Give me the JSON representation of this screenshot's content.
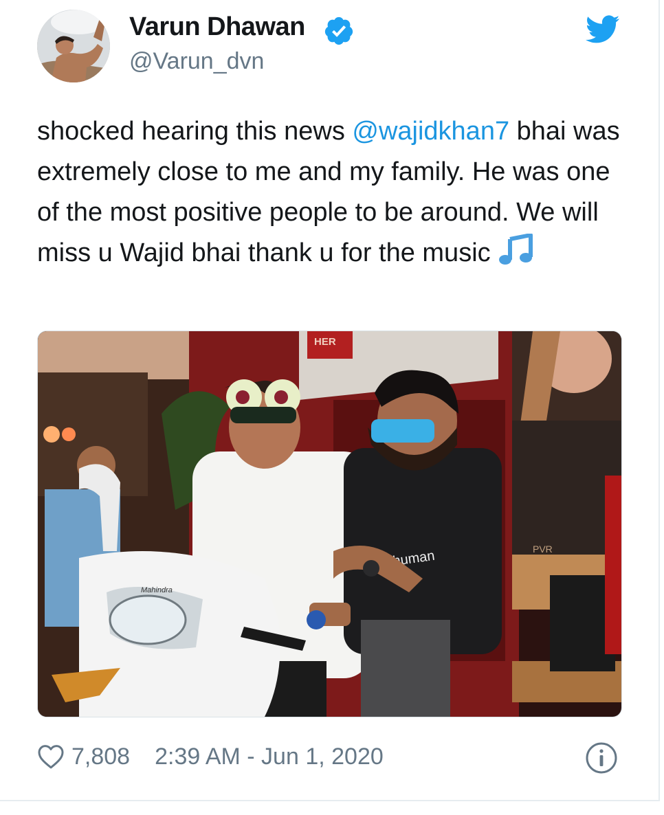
{
  "user": {
    "name": "Varun Dhawan",
    "handle": "@Varun_dvn",
    "verified_icon": "verified-badge-icon",
    "avatar_icon": "avatar"
  },
  "platform_icon": "twitter-bird-icon",
  "tweet": {
    "text_before": "shocked hearing this news ",
    "mention": "@wajidkhan7",
    "text_after": " bhai was extremely close to me and my family. He was one of the most positive people to be around. We will miss u Wajid bhai thank u for the music",
    "emoji_icon": "music-notes-icon"
  },
  "photo": {
    "sign_text": "HER",
    "shirt_text": "ng human",
    "scooter_brand": "Mahindra",
    "banner_text": "PVR"
  },
  "footer": {
    "like_icon": "heart-icon",
    "likes": "7,808",
    "timestamp": "2:39 AM - Jun 1, 2020",
    "info_icon": "info-icon"
  },
  "colors": {
    "accent": "#1b95e0",
    "muted": "#657786",
    "text": "#14171a"
  }
}
